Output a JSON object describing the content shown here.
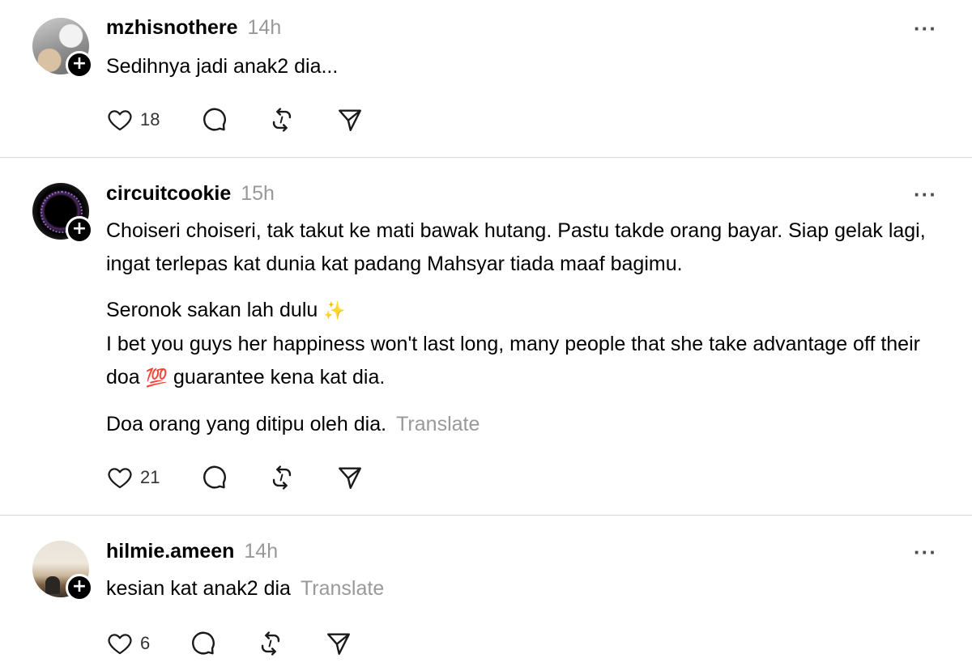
{
  "posts": [
    {
      "username": "mzhisnothere",
      "time": "14h",
      "more": "···",
      "paragraphs": [
        "Sedihnya jadi anak2 dia..."
      ],
      "translate": "",
      "likes": "18",
      "plus": "+"
    },
    {
      "username": "circuitcookie",
      "time": "15h",
      "more": "···",
      "paragraphs": [
        "Choiseri choiseri, tak takut ke mati bawak hutang. Pastu takde orang bayar. Siap gelak lagi, ingat terlepas kat dunia kat padang Mahsyar tiada maaf bagimu.",
        "Seronok sakan lah dulu",
        "I bet you guys her happiness won't last long, many people that she take advantage off their doa",
        "guarantee kena kat dia.",
        "Doa orang yang ditipu oleh dia."
      ],
      "emoji_sparkles": "✨",
      "emoji_hundred": "💯",
      "translate": "Translate",
      "likes": "21",
      "plus": "+"
    },
    {
      "username": "hilmie.ameen",
      "time": "14h",
      "more": "···",
      "paragraphs": [
        "kesian kat anak2 dia"
      ],
      "translate": "Translate",
      "likes": "6",
      "plus": "+"
    }
  ],
  "icons": {
    "like": "heart-icon",
    "reply": "comment-icon",
    "repost": "repost-icon",
    "share": "send-icon",
    "follow": "plus-icon",
    "more": "more-icon"
  }
}
